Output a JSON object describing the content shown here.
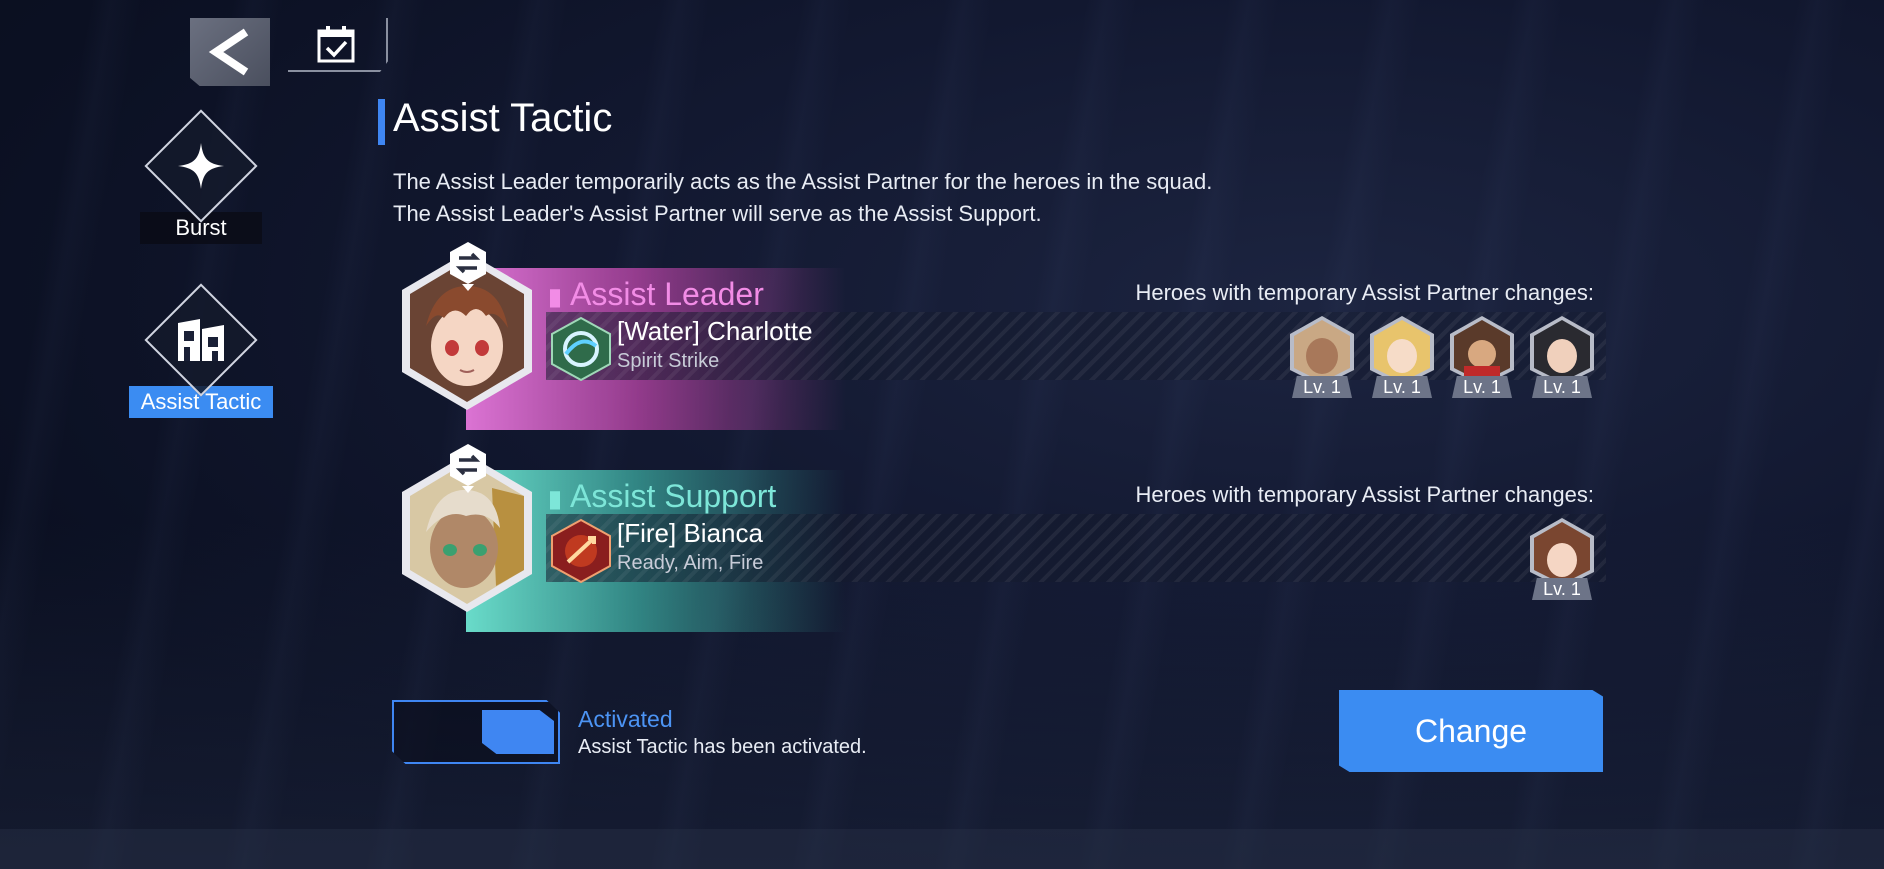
{
  "top": {
    "back_icon": "chevron-left-icon",
    "calendar_icon": "calendar-check-icon"
  },
  "sidebar": {
    "items": [
      {
        "label": "Burst",
        "icon": "sparkle-icon",
        "active": false
      },
      {
        "label": "Assist Tactic",
        "icon": "assist-tactic-icon",
        "active": true
      }
    ]
  },
  "main": {
    "title": "Assist Tactic",
    "description_lines": [
      "The Assist Leader temporarily acts as the Assist Partner for the heroes in the squad.",
      "The Assist Leader's Assist Partner will serve as the Assist Support."
    ],
    "leader": {
      "role": "Assist Leader",
      "hero": "[Water] Charlotte",
      "skill": "Spirit Strike",
      "changes_label": "Heroes with temporary Assist Partner changes:",
      "heroes": [
        {
          "level": "Lv. 1"
        },
        {
          "level": "Lv. 1"
        },
        {
          "level": "Lv. 1"
        },
        {
          "level": "Lv. 1"
        }
      ]
    },
    "support": {
      "role": "Assist Support",
      "hero": "[Fire] Bianca",
      "skill": "Ready, Aim, Fire",
      "changes_label": "Heroes with temporary Assist Partner changes:",
      "heroes": [
        {
          "level": "Lv. 1"
        }
      ]
    }
  },
  "status": {
    "toggle_on": true,
    "title": "Activated",
    "description": "Assist Tactic has been activated."
  },
  "change_button": "Change",
  "colors": {
    "accent": "#3b8cf2",
    "leader": "#f28ce6",
    "support": "#7de6d8"
  }
}
